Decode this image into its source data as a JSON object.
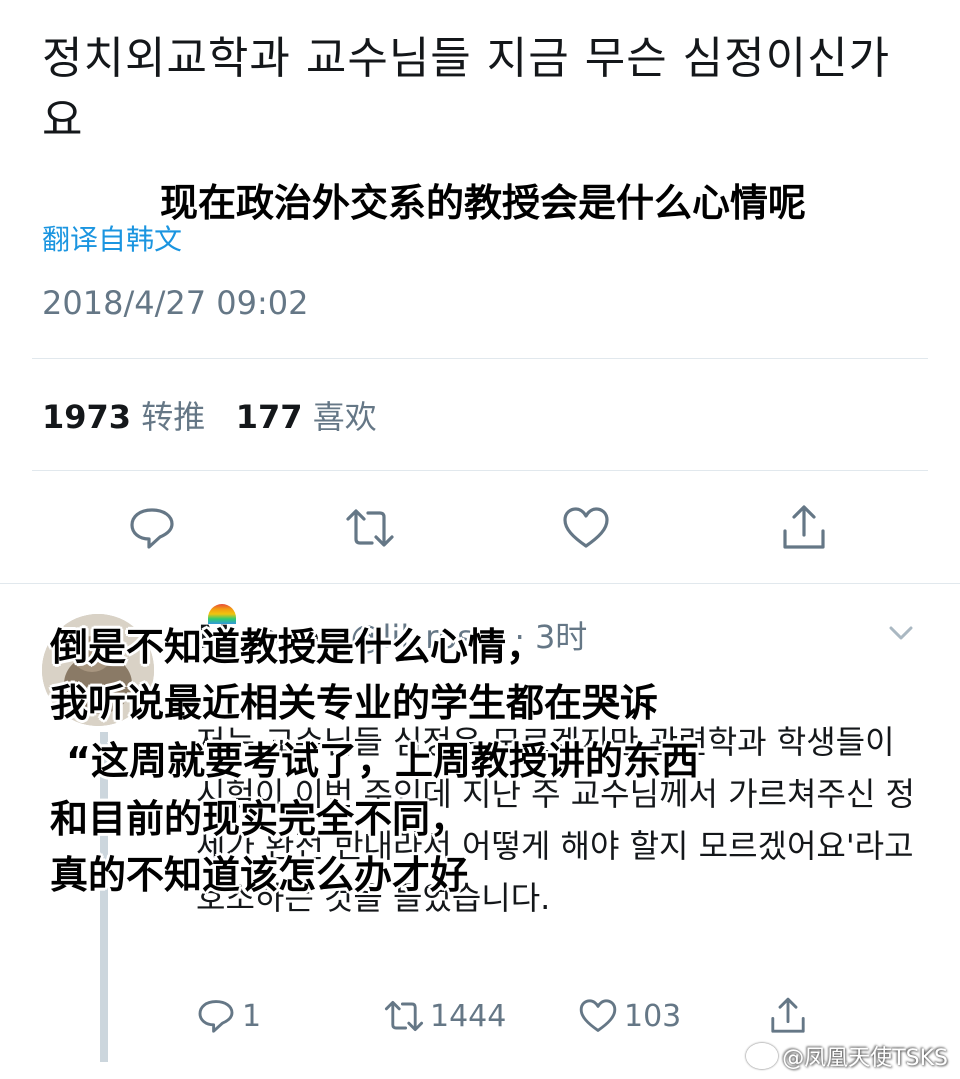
{
  "tweet": {
    "text": "정치외교학과 교수님들 지금 무슨 심정이신가요",
    "translate_label": "翻译自韩文",
    "timestamp": "2018/4/27 09:02",
    "retweets_count": "1973",
    "retweets_label": "转推",
    "likes_count": "177",
    "likes_label": "喜欢"
  },
  "reply": {
    "name": "M  rosey",
    "handle": "@lil_ros...",
    "time": "· 3时",
    "text": "저는 교수님들 심정은 모르겠지만 관련학과 학생들이 시험이 이번 주인데 지난 주 교수님께서 가르쳐주신 정세가 완전 반대라서 어떻게 해야 할지 모르겠어요'라고 호소하는 것을 들었습니다.",
    "reply_count": "1",
    "retweet_count": "1444",
    "like_count": "103"
  },
  "subtitles": {
    "tweet_translation": "现在政治外交系的教授会是什么心情呢",
    "reply_line1": "倒是不知道教授是什么心情，",
    "reply_line2": "我听说最近相关专业的学生都在哭诉",
    "reply_line3": "“这周就要考试了，上周教授讲的东西",
    "reply_line4": "和目前的现实完全不同，",
    "reply_line5": "真的不知道该怎么办才好"
  },
  "watermark": "@凤凰天使TSKS",
  "icons": [
    "reply-icon",
    "retweet-icon",
    "like-icon",
    "share-icon",
    "chevron-down-icon"
  ],
  "colors": {
    "link": "#1b95e0",
    "muted": "#657786",
    "text": "#14171a",
    "divider": "#e1e8ed"
  }
}
